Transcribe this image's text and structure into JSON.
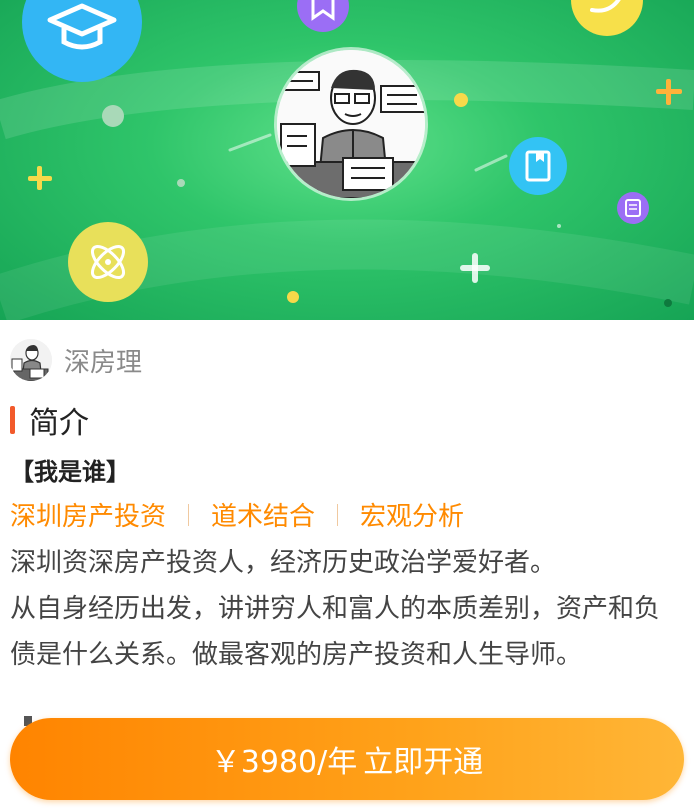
{
  "hero": {
    "avatar_icon": "cartoon-author-avatar",
    "decorative_icons": [
      "graduation-cap-icon",
      "bookmark-icon",
      "atom-icon",
      "book-icon",
      "document-icon",
      "plus-icon",
      "leaf-icon"
    ]
  },
  "author": {
    "name": "深房理"
  },
  "section": {
    "title": "简介"
  },
  "intro": {
    "who_title": "【我是谁】",
    "tags": [
      "深圳房产投资",
      "道术结合",
      "宏观分析"
    ],
    "lines": [
      "深圳资深房产投资人，经济历史政治学爱好者。",
      "从自身经历出发，讲讲穷人和富人的本质差别，资产和负",
      "债是什么关系。做最客观的房产投资和人生导师。"
    ]
  },
  "cta": {
    "price": "￥3980/年",
    "action": "立即开通"
  },
  "colors": {
    "accent": "#ff8a00",
    "section_bar": "#f25a2b",
    "hero_green": "#2fc56a"
  }
}
